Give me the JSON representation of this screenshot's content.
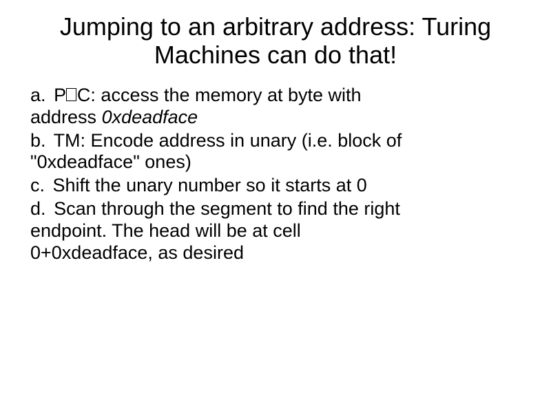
{
  "title": "Jumping to an arbitrary address: Turing Machines can do that!",
  "items": {
    "a": {
      "line1_pre": "P",
      "line1_post": "C: access the memory at byte with",
      "line2_a": "address ",
      "line2_b": "0xdeadface"
    },
    "b": {
      "line1": "TM: Encode address in unary (i.e. block of",
      "line2": "\"0xdeadface\" ones)"
    },
    "c": {
      "line1": "Shift the unary number so it starts at 0"
    },
    "d": {
      "line1": "Scan through the segment to find the right",
      "line2": "endpoint. The head will be at cell",
      "line3": "0+0xdeadface, as desired"
    }
  }
}
